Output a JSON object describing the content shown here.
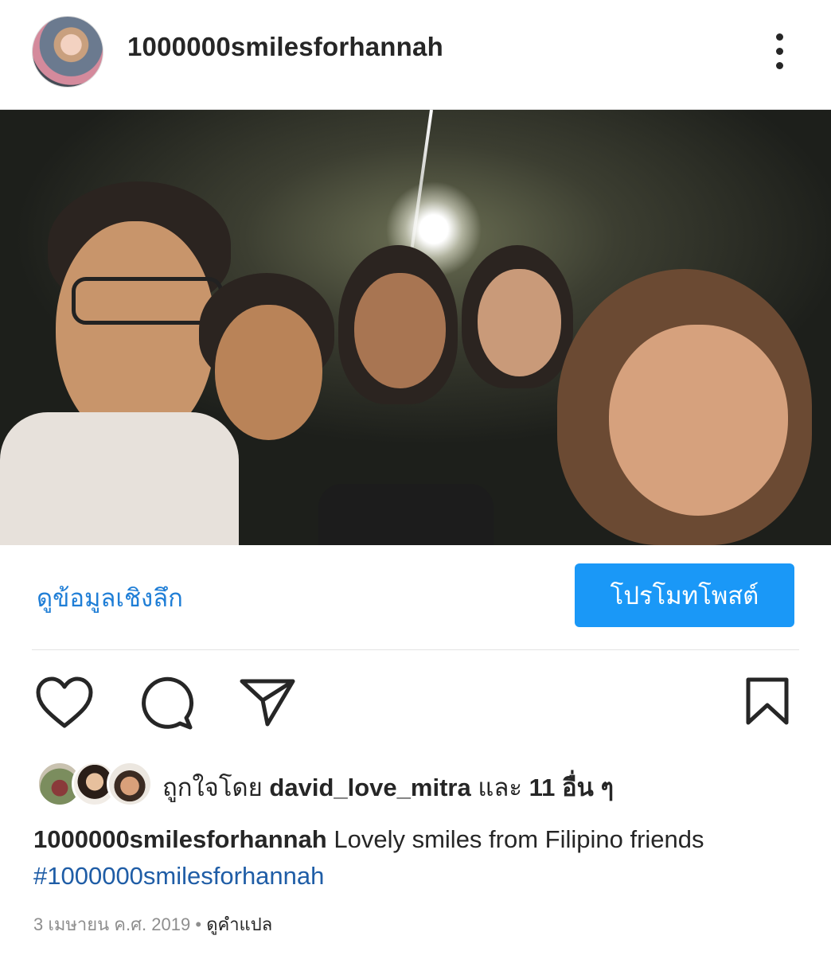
{
  "post": {
    "username": "1000000smilesforhannah",
    "more_icon": "more-vertical-icon"
  },
  "insights": {
    "link_label": "ดูข้อมูลเชิงลึก",
    "promote_label": "โปรโมทโพสต์"
  },
  "actions": {
    "like_icon": "heart-icon",
    "comment_icon": "comment-icon",
    "share_icon": "send-icon",
    "save_icon": "bookmark-icon"
  },
  "likes": {
    "prefix": "ถูกใจโดย",
    "user": "david_love_mitra",
    "conj": "และ",
    "others": "11 อื่น ๆ"
  },
  "caption": {
    "user": "1000000smilesforhannah",
    "text": "Lovely smiles from Filipino friends",
    "hashtag": "#1000000smilesforhannah"
  },
  "meta": {
    "date": "3 เมษายน ค.ศ. 2019",
    "separator": "•",
    "translate": "ดูคำแปล"
  },
  "colors": {
    "link": "#1f7ed6",
    "button": "#1a98f7",
    "hashtag": "#1f5da6",
    "muted": "#8e8e8e"
  }
}
